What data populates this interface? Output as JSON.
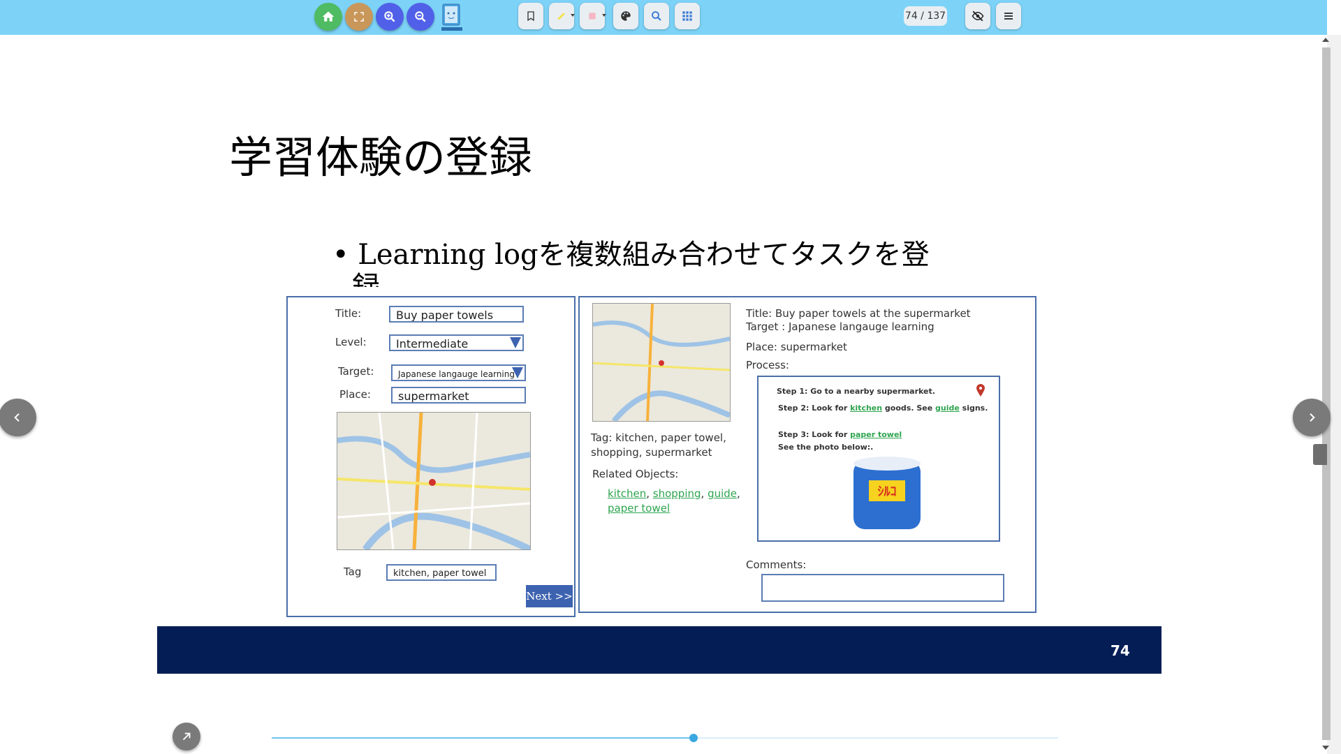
{
  "toolbar": {
    "colors": {
      "background": "#7dd3f7",
      "home": "#4fbb62",
      "fullscreen": "#c9975a",
      "zoom": "#5060e8"
    },
    "buttons": [
      {
        "name": "home-button",
        "icon": "home-icon"
      },
      {
        "name": "fullscreen-button",
        "icon": "fullscreen-icon"
      },
      {
        "name": "zoom-in-button",
        "icon": "zoom-in-icon"
      },
      {
        "name": "zoom-out-button",
        "icon": "zoom-out-icon"
      },
      {
        "name": "app-logo",
        "icon": "digital-book-logo-icon"
      },
      {
        "name": "bookmark-button",
        "icon": "bookmark-icon"
      },
      {
        "name": "highlighter-button",
        "icon": "highlighter-icon"
      },
      {
        "name": "eraser-button",
        "icon": "eraser-icon"
      },
      {
        "name": "palette-button",
        "icon": "palette-icon"
      },
      {
        "name": "search-button",
        "icon": "search-icon"
      },
      {
        "name": "thumbnails-button",
        "icon": "grid-icon"
      },
      {
        "name": "hide-button",
        "icon": "eye-off-icon"
      },
      {
        "name": "menu-button",
        "icon": "hamburger-menu-icon"
      }
    ],
    "page_indicator": "74 / 137"
  },
  "slide": {
    "title": "学習体験の登録",
    "bullet": "• Learning logを複数組み合わせてタスクを登",
    "bullet_cont": "録",
    "left_form": {
      "title_label": "Title:",
      "title_value": "Buy paper towels",
      "level_label": "Level:",
      "level_value": "Intermediate",
      "target_label": "Target:",
      "target_value": "Japanese langauge learning",
      "place_label": "Place:",
      "place_value": "supermarket",
      "tag_label": "Tag",
      "tag_value": "kitchen, paper towel",
      "next_button": "Next >>"
    },
    "right_detail": {
      "title_line": "Title:   Buy paper towels at the supermarket",
      "target_line": "Target :  Japanese langauge learning",
      "place_line": "Place: supermarket",
      "process_label": "Process:",
      "step1": "Step 1: Go to a nearby supermarket.",
      "step2_prefix": "Step 2: Look for ",
      "step2_link1": "kitchen",
      "step2_mid": " goods.  See ",
      "step2_link2": "guide",
      "step2_suffix": " signs.",
      "step3_prefix": "Step 3: Look for ",
      "step3_link": "paper towel",
      "step3_line2": "See the photo below:.",
      "tag_line1": "Tag: kitchen, paper towel,",
      "tag_line2": "shopping, supermarket",
      "related_label": "Related Objects:",
      "related_links": [
        "kitchen",
        "shopping",
        "guide",
        "paper towel"
      ],
      "comments_label": "Comments:"
    },
    "page_number": "74",
    "footer_color": "#051d55"
  },
  "navigation": {
    "prev_icon": "chevron-left-icon",
    "next_icon": "chevron-right-icon",
    "expand_icon": "arrow-up-right-icon"
  },
  "progress": {
    "current_page": 74,
    "total_pages": 137
  }
}
